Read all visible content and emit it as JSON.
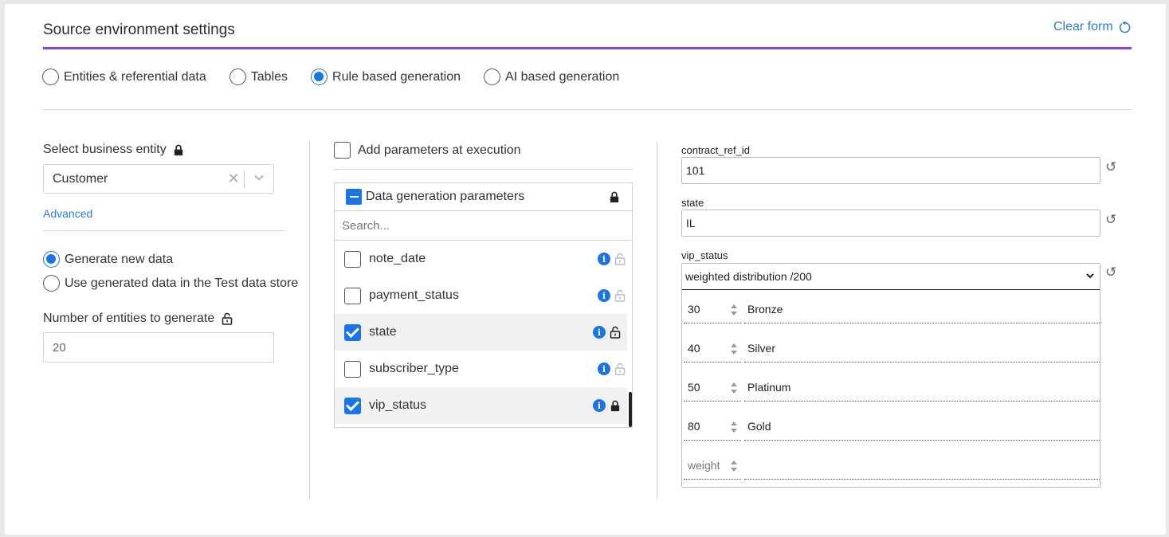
{
  "header": {
    "title": "Source environment settings",
    "clear_form": "Clear form"
  },
  "source_types": [
    {
      "label": "Entities & referential data",
      "selected": false
    },
    {
      "label": "Tables",
      "selected": false
    },
    {
      "label": "Rule based generation",
      "selected": true
    },
    {
      "label": "AI based generation",
      "selected": false
    }
  ],
  "left": {
    "business_entity_label": "Select business entity",
    "business_entity_value": "Customer",
    "advanced_link": "Advanced",
    "generate_new": "Generate new data",
    "use_generated": "Use generated data in the Test data store",
    "num_entities_label": "Number of entities to generate",
    "num_entities_value": "20"
  },
  "middle": {
    "add_params_label": "Add parameters at execution",
    "panel_title": "Data generation parameters",
    "search_placeholder": "Search...",
    "params": [
      {
        "name": "note_date",
        "checked": false
      },
      {
        "name": "payment_status",
        "checked": false
      },
      {
        "name": "state",
        "checked": true
      },
      {
        "name": "subscriber_type",
        "checked": false
      },
      {
        "name": "vip_status",
        "checked": true
      }
    ]
  },
  "right": {
    "contract_label": "contract_ref_id",
    "contract_value": "101",
    "state_label": "state",
    "state_value": "IL",
    "vip_label": "vip_status",
    "vip_select": "weighted distribution /200",
    "distribution": [
      {
        "weight": "30",
        "value": "Bronze"
      },
      {
        "weight": "40",
        "value": "Silver"
      },
      {
        "weight": "50",
        "value": "Platinum"
      },
      {
        "weight": "80",
        "value": "Gold"
      }
    ],
    "weight_placeholder": "weight"
  },
  "colors": {
    "accent": "#1a73e8",
    "purple": "#8c3fe0",
    "link": "#2e7bd6"
  }
}
